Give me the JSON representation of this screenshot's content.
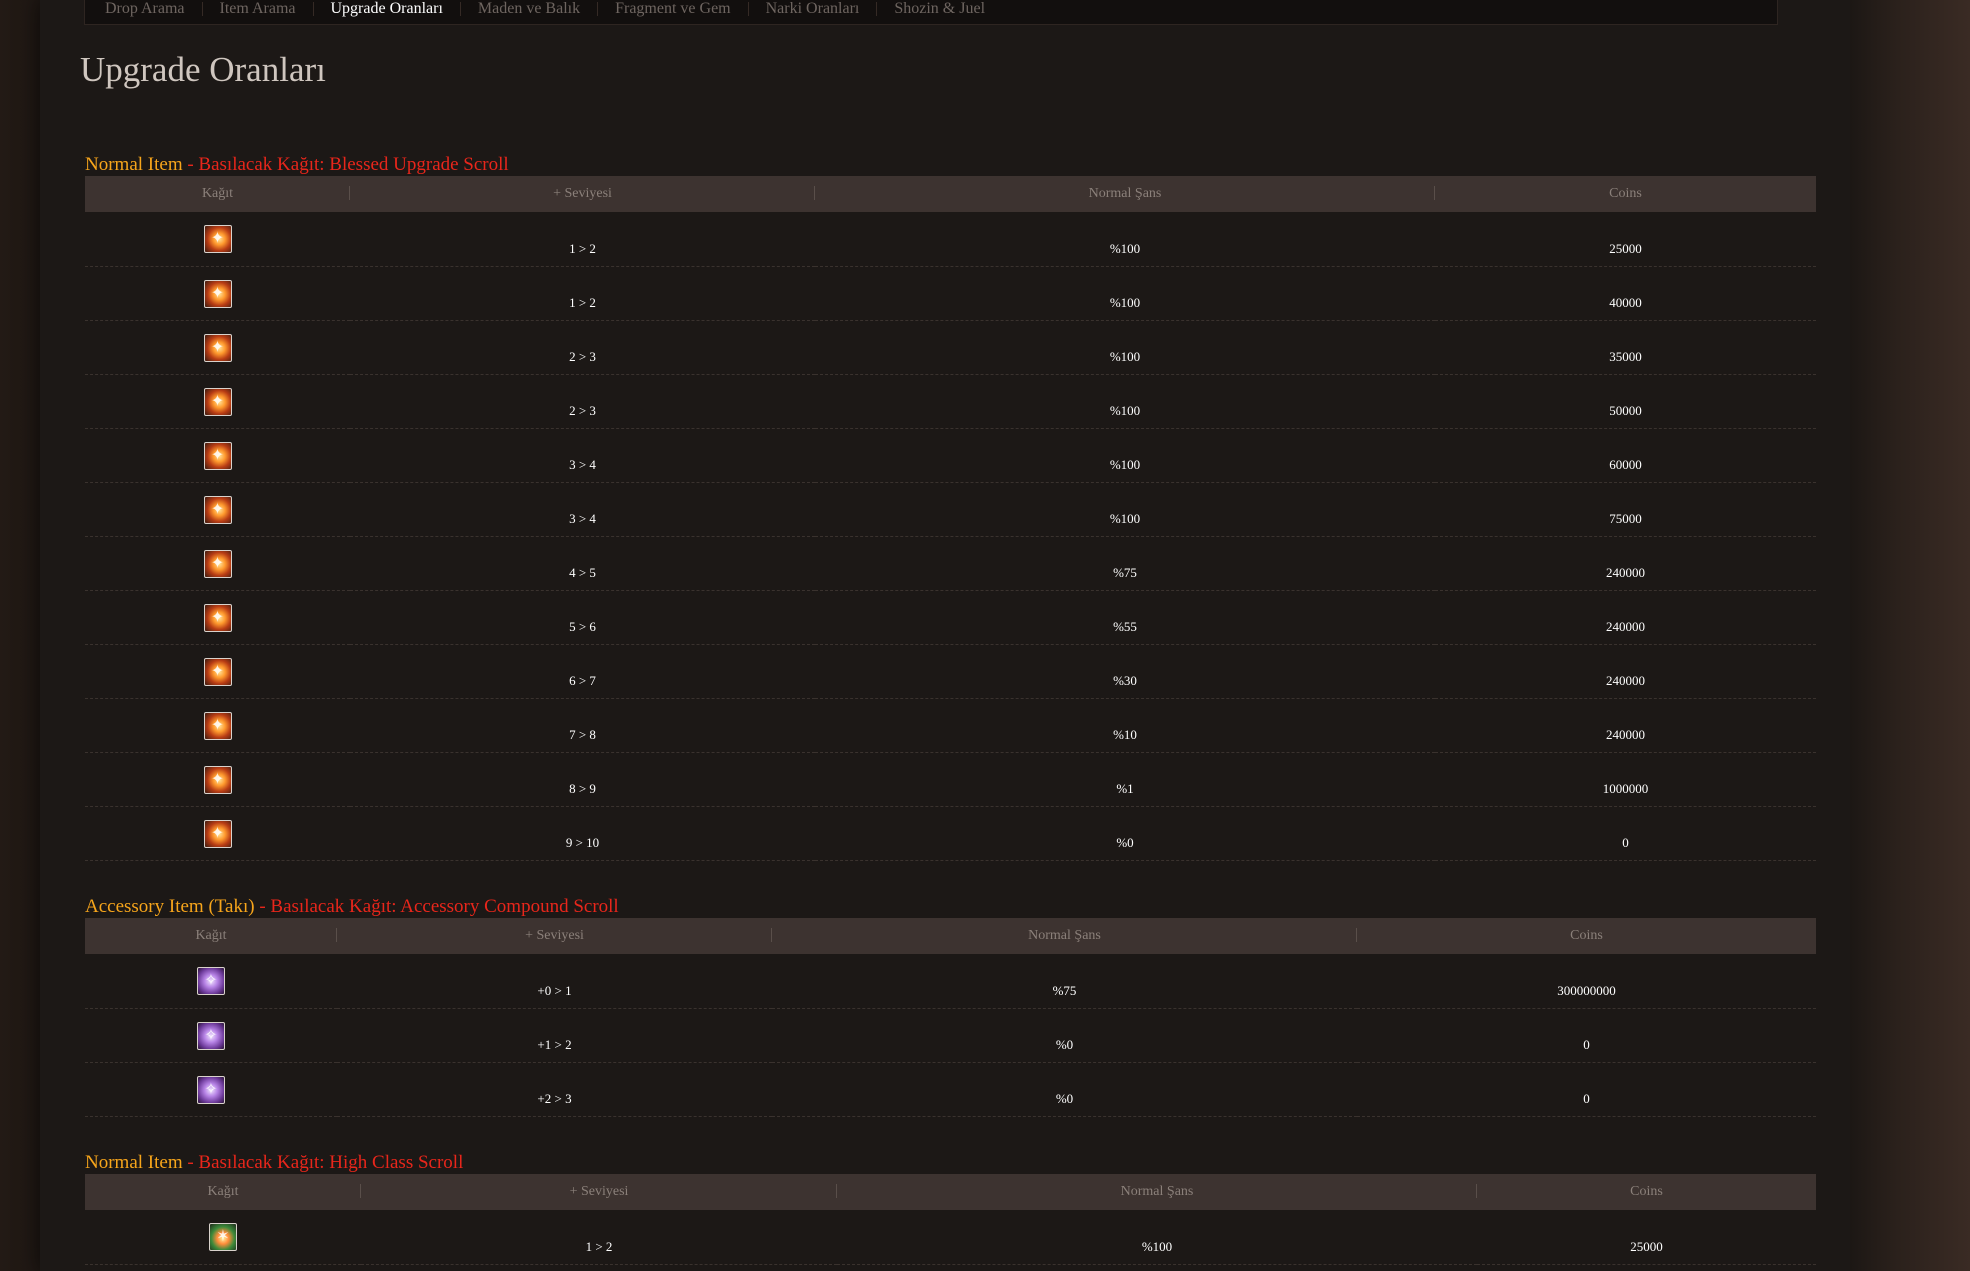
{
  "nav": [
    "Drop Arama",
    "Item Arama",
    "Upgrade Oranları",
    "Maden ve Balık",
    "Fragment ve Gem",
    "Narki Oranları",
    "Shozin & Juel"
  ],
  "nav_active": "Upgrade Oranları",
  "page_title": "Upgrade Oranları",
  "columns": [
    "Kağıt",
    "+ Seviyesi",
    "Normal Şans",
    "Coins"
  ],
  "sections": [
    {
      "category": "Normal Item",
      "scroll_label": " - Basılacak Kağıt: Blessed Upgrade Scroll",
      "icon": "blessed-upgrade-scroll-icon",
      "rows": [
        {
          "level": "1 > 2",
          "chance": "%100",
          "coins": "25000"
        },
        {
          "level": "1 > 2",
          "chance": "%100",
          "coins": "40000"
        },
        {
          "level": "2 > 3",
          "chance": "%100",
          "coins": "35000"
        },
        {
          "level": "2 > 3",
          "chance": "%100",
          "coins": "50000"
        },
        {
          "level": "3 > 4",
          "chance": "%100",
          "coins": "60000"
        },
        {
          "level": "3 > 4",
          "chance": "%100",
          "coins": "75000"
        },
        {
          "level": "4 > 5",
          "chance": "%75",
          "coins": "240000"
        },
        {
          "level": "5 > 6",
          "chance": "%55",
          "coins": "240000"
        },
        {
          "level": "6 > 7",
          "chance": "%30",
          "coins": "240000"
        },
        {
          "level": "7 > 8",
          "chance": "%10",
          "coins": "240000"
        },
        {
          "level": "8 > 9",
          "chance": "%1",
          "coins": "1000000"
        },
        {
          "level": "9 > 10",
          "chance": "%0",
          "coins": "0"
        }
      ]
    },
    {
      "category": "Accessory Item (Takı)",
      "scroll_label": " - Basılacak Kağıt: Accessory Compound Scroll",
      "icon": "accessory-compound-scroll-icon",
      "rows": [
        {
          "level": "+0 > 1",
          "chance": "%75",
          "coins": "300000000"
        },
        {
          "level": "+1 > 2",
          "chance": "%0",
          "coins": "0"
        },
        {
          "level": "+2 > 3",
          "chance": "%0",
          "coins": "0"
        }
      ]
    },
    {
      "category": "Normal Item",
      "scroll_label": " - Basılacak Kağıt: High Class Scroll",
      "icon": "high-class-scroll-icon",
      "rows": [
        {
          "level": "1 > 2",
          "chance": "%100",
          "coins": "25000"
        }
      ]
    }
  ]
}
